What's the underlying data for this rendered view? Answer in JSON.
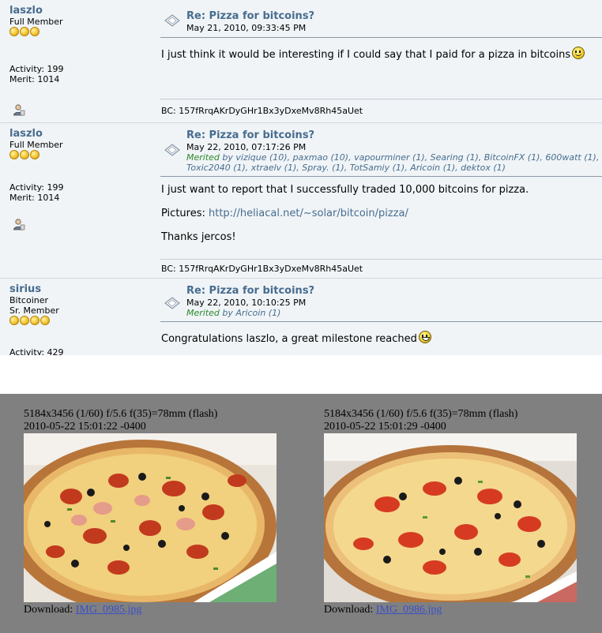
{
  "posts": [
    {
      "author": "laszlo",
      "rank": "Full Member",
      "activity": "Activity: 199",
      "merit_count": "Merit: 1014",
      "subject": "Re: Pizza for bitcoins?",
      "date": "May 21, 2010, 09:33:45 PM",
      "body": [
        "I just think it would be interesting if I could say that I paid for a pizza in bitcoins"
      ],
      "signature": "BC: 157fRrqAKrDyGHr1Bx3yDxeMv8Rh45aUet"
    },
    {
      "author": "laszlo",
      "rank": "Full Member",
      "activity": "Activity: 199",
      "merit_count": "Merit: 1014",
      "subject": "Re: Pizza for bitcoins?",
      "date": "May 22, 2010, 07:17:26 PM",
      "merited_word": "Merited",
      "merited_line1": " by vizique (10), paxmao (10), vapourminer (1), Searing (1), BitcoinFX (1), 600watt (1),",
      "merited_line2": "Toxic2040 (1), xtraelv (1), Spray. (1), TotSamiy (1), Aricoin (1), dektox (1)",
      "body": [
        "I just want to report that I successfully traded 10,000 bitcoins for pizza.",
        "Pictures: ",
        "Thanks jercos!"
      ],
      "link": "http://heliacal.net/~solar/bitcoin/pizza/",
      "signature": "BC: 157fRrqAKrDyGHr1Bx3yDxeMv8Rh45aUet"
    },
    {
      "author": "sirius",
      "rank": "Bitcoiner",
      "rank2": "Sr. Member",
      "activity": "Activity: 429",
      "subject": "Re: Pizza for bitcoins?",
      "date": "May 22, 2010, 10:10:25 PM",
      "merited_word": "Merited",
      "merited_line1": " by Aricoin (1)",
      "body": [
        "Congratulations laszlo, a great milestone reached"
      ]
    }
  ],
  "gallery": [
    {
      "meta": "5184x3456 (1/60) f/5.6 f(35)=78mm (flash)",
      "timestamp": "2010-05-22 15:01:22 -0400",
      "download_label": "Download: ",
      "file": "IMG_0985.jpg"
    },
    {
      "meta": "5184x3456 (1/60) f/5.6 f(35)=78mm (flash)",
      "timestamp": "2010-05-22 15:01:29 -0400",
      "download_label": "Download: ",
      "file": "IMG_0986.jpg"
    }
  ],
  "colors": {
    "link": "#476c8e",
    "merited": "#2c8a2c",
    "gallery_bg": "#808080"
  },
  "icons": [
    "profile-icon",
    "xpost-icon",
    "smiley-icon",
    "grin-icon"
  ]
}
